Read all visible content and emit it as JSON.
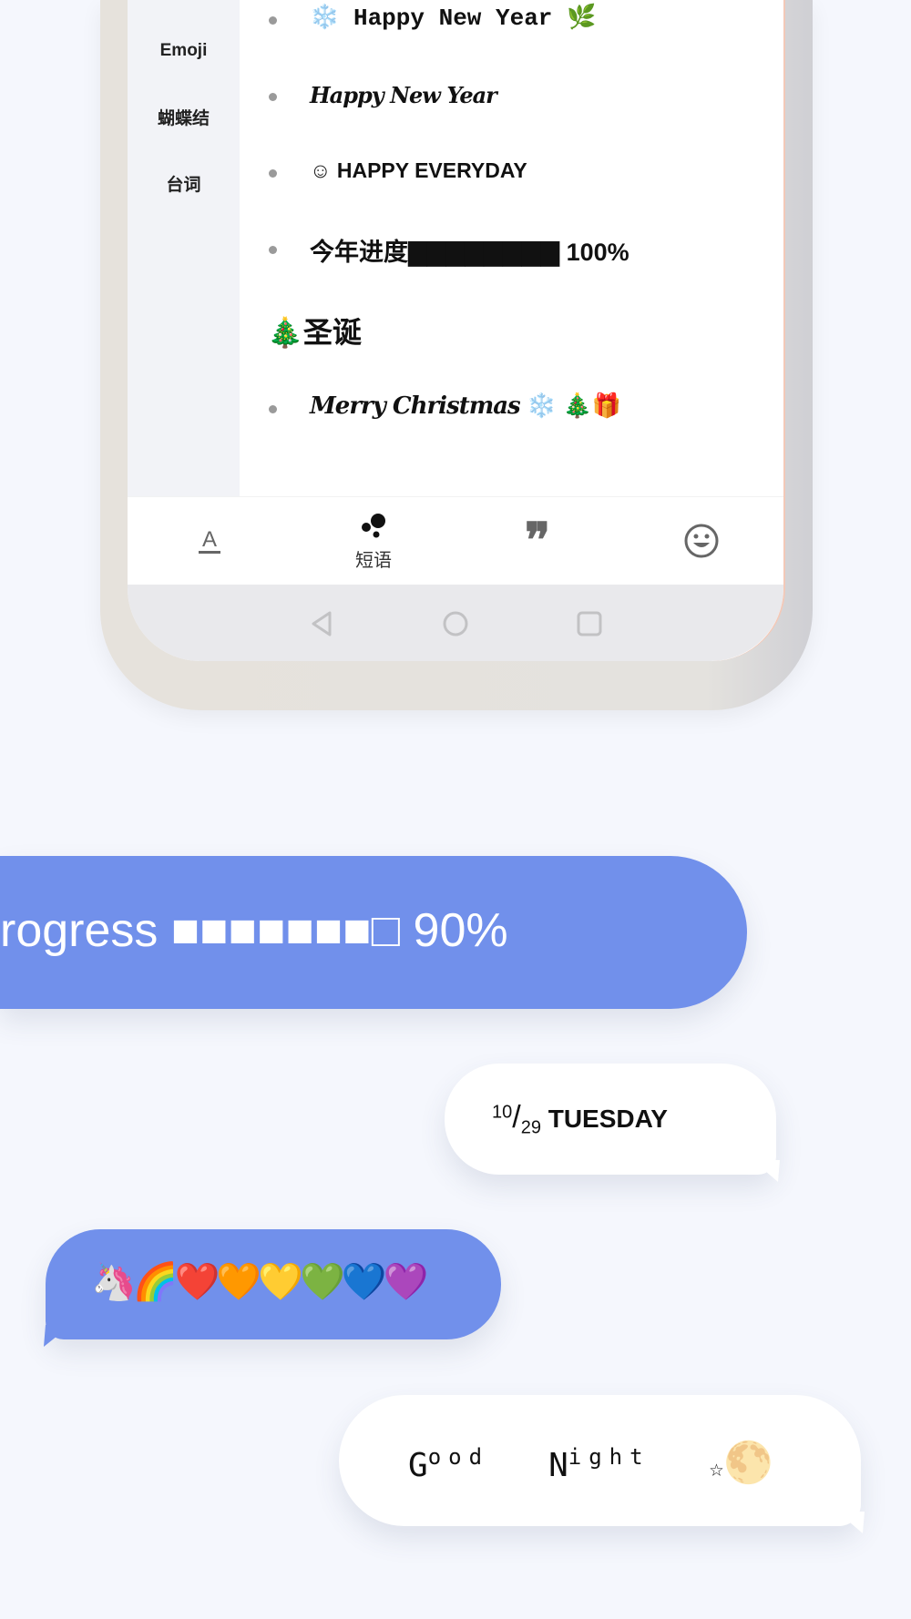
{
  "sidebar": {
    "items": [
      {
        "label": "Emoji"
      },
      {
        "label": "蝴蝶结"
      },
      {
        "label": "台词"
      }
    ]
  },
  "content": {
    "items": [
      {
        "text": "❄️ Happy New Year 🌿"
      },
      {
        "text": "Happy New Year"
      },
      {
        "text": "☺ HAPPY EVERYDAY"
      },
      {
        "text": "今年进度▇▇▇▇▇▇▇▇ 100%"
      }
    ],
    "section_header": "🎄圣诞",
    "christmas_items": [
      {
        "text": "Merry Christmas",
        "emoji": "❄️ 🎄🎁"
      }
    ]
  },
  "tabbar": {
    "tabs": [
      {
        "icon": "font-icon",
        "label": ""
      },
      {
        "icon": "bubbles-icon",
        "label": "短语"
      },
      {
        "icon": "quote-icon",
        "label": ""
      },
      {
        "icon": "smiley-icon",
        "label": ""
      }
    ],
    "active_index": 1
  },
  "navbar": {
    "icons": [
      "back-icon",
      "home-icon",
      "recents-icon"
    ]
  },
  "bubbles": {
    "progress": {
      "text": "rogress ■■■■■■■□ 90%"
    },
    "date": {
      "sup": "10",
      "slash": "/",
      "sub": "29",
      "day": "TUESDAY"
    },
    "emoji": {
      "text": "🦄🌈❤️🧡💛💚💙💜"
    },
    "goodnight": {
      "g": "G",
      "ood": "ood",
      "n": "N",
      "ight": "ight",
      "star": "☆",
      "moon": "🌕"
    }
  },
  "colors": {
    "bubble_blue": "#7190eb",
    "background": "#f5f7fd"
  }
}
